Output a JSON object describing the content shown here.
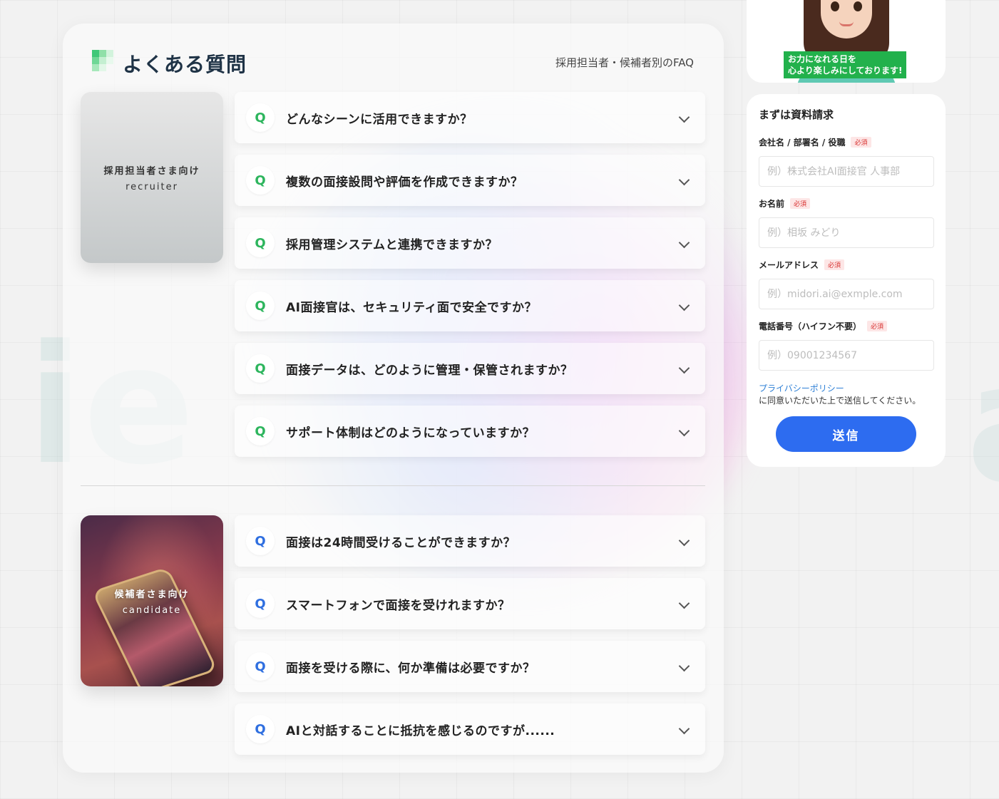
{
  "faq": {
    "title": "よくある質問",
    "subtitle": "採用担当者・候補者別のFAQ",
    "q_mark": "Q",
    "recruiter": {
      "label_ja": "採用担当者さま向け",
      "label_en": "recruiter",
      "questions": [
        "どんなシーンに活用できますか？",
        "複数の面接設問や評価を作成できますか？",
        "採用管理システムと連携できますか？",
        "AI面接官は、セキュリティ面で安全ですか？",
        "面接データは、どのように管理・保管されますか？",
        "サポート体制はどのようになっていますか？"
      ]
    },
    "candidate": {
      "label_ja": "候補者さま向け",
      "label_en": "candidate",
      "questions": [
        "面接は24時間受けることができますか？",
        "スマートフォンで面接を受けれますか？",
        "面接を受ける際に、何か準備は必要ですか？",
        "AIと対話することに抵抗を感じるのですが......"
      ]
    }
  },
  "avatar": {
    "caption_line1": "お力になれる日を",
    "caption_line2": "心より楽しみにしております!"
  },
  "form": {
    "title": "まずは資料請求",
    "required_label": "必須",
    "fields": [
      {
        "label": "会社名 / 部署名 / 役職",
        "placeholder": "例）株式会社AI面接官 人事部",
        "value": ""
      },
      {
        "label": "お名前",
        "placeholder": "例）相坂 みどり",
        "value": ""
      },
      {
        "label": "メールアドレス",
        "placeholder": "例）midori.ai@exmple.com",
        "value": ""
      },
      {
        "label": "電話番号（ハイフン不要）",
        "placeholder": "例）09001234567",
        "value": ""
      }
    ],
    "policy_link": "プライバシーポリシー",
    "policy_text": "に同意いただいた上で送信してください。",
    "submit_label": "送信"
  },
  "colors": {
    "recruiter_q": "#2db55d",
    "candidate_q": "#2f6fe0",
    "submit": "#2d6cf0",
    "required": "#d8302f",
    "caption_bg": "#22b14c"
  },
  "decor": {
    "bg_letter_left": "ie",
    "bg_letter_right": "a"
  }
}
